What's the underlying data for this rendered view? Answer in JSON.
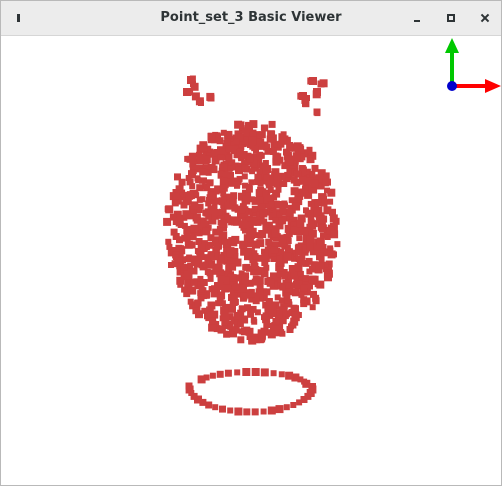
{
  "window": {
    "title": "Point_set_3 Basic Viewer"
  },
  "viewer": {
    "point_color": "#cc3f3f",
    "axis_colors": {
      "x": "#ff0000",
      "y": "#00c800",
      "z": "#0000cc"
    }
  }
}
